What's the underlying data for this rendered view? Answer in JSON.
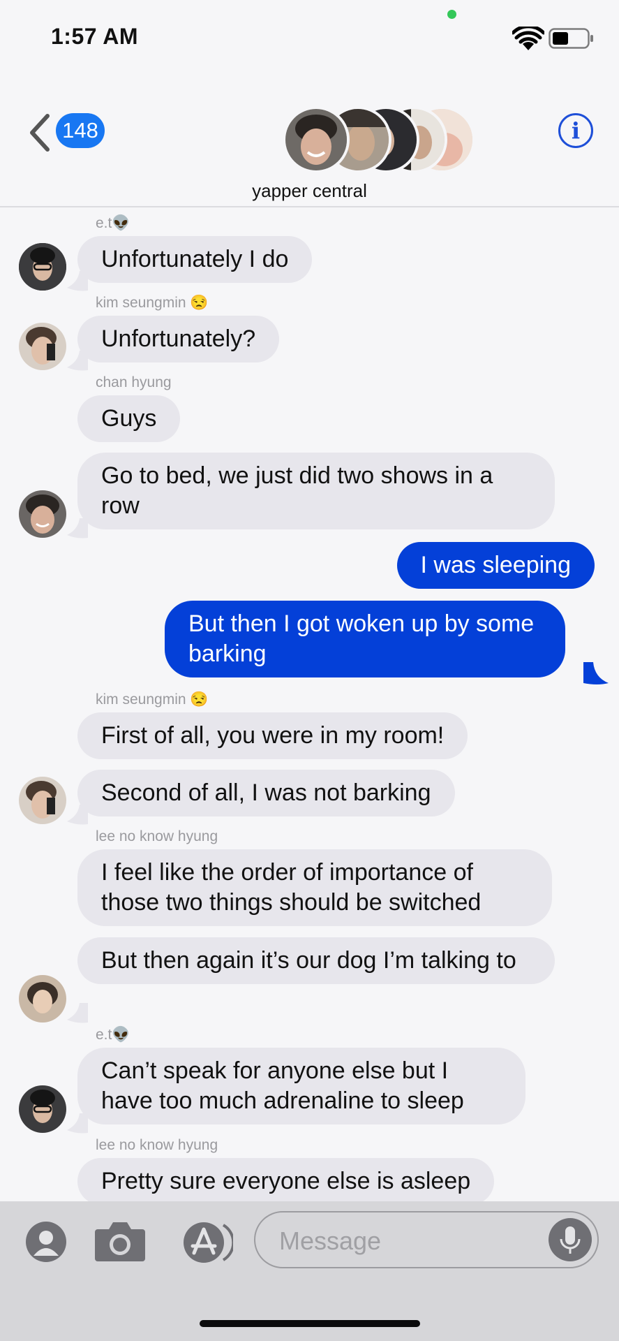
{
  "status_bar": {
    "time": "1:57 AM"
  },
  "header": {
    "back_count": "148",
    "group_name": "yapper central",
    "info_label": "i"
  },
  "thread": {
    "senders": [
      "e.t👽",
      "kim seungmin 😒",
      "chan hyung",
      "kim seungmin 😒",
      "lee no know hyung",
      "e.t👽",
      "lee no know hyung"
    ],
    "messages": [
      "Unfortunately I do",
      "Unfortunately?",
      "Guys",
      "Go to bed, we just did two shows in a row",
      "I was sleeping",
      "But then I got woken up by some barking",
      "First of all, you were in my room!",
      "Second of all, I was not barking",
      "I feel like the order of importance of those two things should be switched",
      "But then again it’s our dog I’m talking to",
      "Can’t speak for anyone else but I have too much adrenaline to sleep",
      "Pretty sure everyone else is asleep"
    ]
  },
  "input_bar": {
    "placeholder": "Message"
  },
  "colors": {
    "outgoing_bubble": "#0440d8",
    "incoming_bubble": "#e7e6ec",
    "badge": "#1877f2"
  }
}
